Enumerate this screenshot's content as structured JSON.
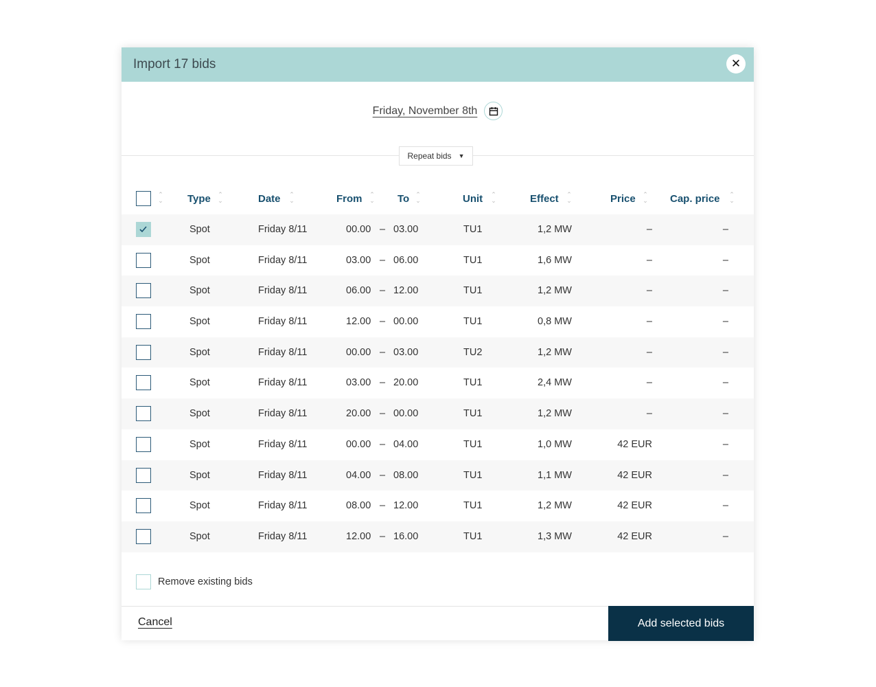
{
  "title": "Import 17 bids",
  "date_label": "Friday, November 8th",
  "repeat_label": "Repeat bids",
  "columns": [
    "Type",
    "Date",
    "From",
    "To",
    "Unit",
    "Effect",
    "Price",
    "Cap. price"
  ],
  "rows": [
    {
      "checked": true,
      "type": "Spot",
      "date": "Friday 8/11",
      "from": "00.00",
      "to": "03.00",
      "unit": "TU1",
      "effect": "1,2 MW",
      "price": "–",
      "cap": "–"
    },
    {
      "checked": false,
      "type": "Spot",
      "date": "Friday 8/11",
      "from": "03.00",
      "to": "06.00",
      "unit": "TU1",
      "effect": "1,6 MW",
      "price": "–",
      "cap": "–"
    },
    {
      "checked": false,
      "type": "Spot",
      "date": "Friday 8/11",
      "from": "06.00",
      "to": "12.00",
      "unit": "TU1",
      "effect": "1,2 MW",
      "price": "–",
      "cap": "–"
    },
    {
      "checked": false,
      "type": "Spot",
      "date": "Friday 8/11",
      "from": "12.00",
      "to": "00.00",
      "unit": "TU1",
      "effect": "0,8 MW",
      "price": "–",
      "cap": "–"
    },
    {
      "checked": false,
      "type": "Spot",
      "date": "Friday 8/11",
      "from": "00.00",
      "to": "03.00",
      "unit": "TU2",
      "effect": "1,2 MW",
      "price": "–",
      "cap": "–"
    },
    {
      "checked": false,
      "type": "Spot",
      "date": "Friday 8/11",
      "from": "03.00",
      "to": "20.00",
      "unit": "TU1",
      "effect": "2,4 MW",
      "price": "–",
      "cap": "–"
    },
    {
      "checked": false,
      "type": "Spot",
      "date": "Friday 8/11",
      "from": "20.00",
      "to": "00.00",
      "unit": "TU1",
      "effect": "1,2 MW",
      "price": "–",
      "cap": "–"
    },
    {
      "checked": false,
      "type": "Spot",
      "date": "Friday 8/11",
      "from": "00.00",
      "to": "04.00",
      "unit": "TU1",
      "effect": "1,0 MW",
      "price": "42 EUR",
      "cap": "–"
    },
    {
      "checked": false,
      "type": "Spot",
      "date": "Friday 8/11",
      "from": "04.00",
      "to": "08.00",
      "unit": "TU1",
      "effect": "1,1 MW",
      "price": "42 EUR",
      "cap": "–"
    },
    {
      "checked": false,
      "type": "Spot",
      "date": "Friday 8/11",
      "from": "08.00",
      "to": "12.00",
      "unit": "TU1",
      "effect": "1,2 MW",
      "price": "42 EUR",
      "cap": "–"
    },
    {
      "checked": false,
      "type": "Spot",
      "date": "Friday 8/11",
      "from": "12.00",
      "to": "16.00",
      "unit": "TU1",
      "effect": "1,3 MW",
      "price": "42 EUR",
      "cap": "–"
    }
  ],
  "range_separator": "–",
  "remove_label": "Remove existing bids",
  "cancel_label": "Cancel",
  "add_label": "Add selected bids",
  "colors": {
    "header": "#acd7d6",
    "primary": "#0a3147",
    "heading_text": "#18506f"
  }
}
